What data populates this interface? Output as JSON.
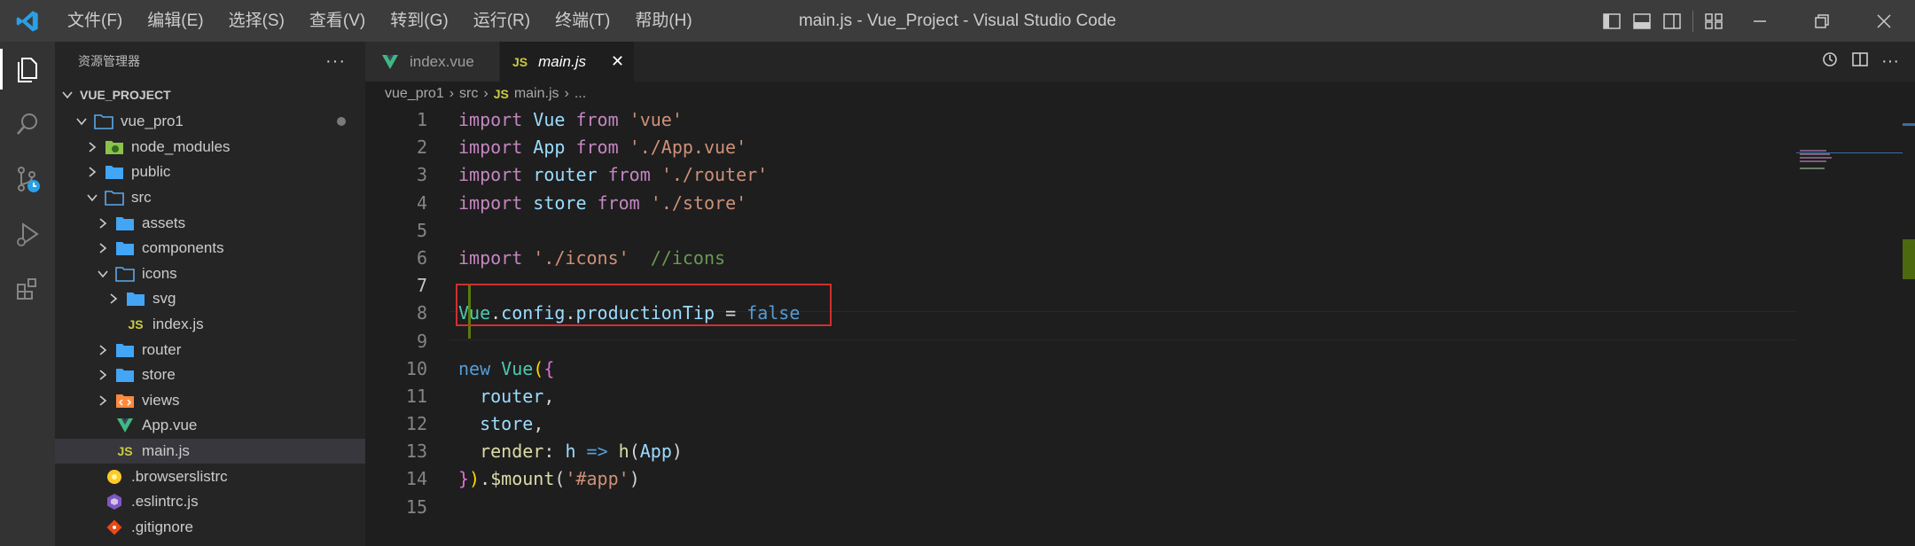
{
  "titlebar": {
    "title": "main.js - Vue_Project - Visual Studio Code",
    "menu": [
      "文件(F)",
      "编辑(E)",
      "选择(S)",
      "查看(V)",
      "转到(G)",
      "运行(R)",
      "终端(T)",
      "帮助(H)"
    ]
  },
  "sidebar": {
    "header": "资源管理器",
    "more": "···",
    "project": "VUE_PROJECT",
    "tree": [
      {
        "label": "vue_pro1",
        "type": "folder-open"
      },
      {
        "label": "node_modules",
        "type": "node-folder"
      },
      {
        "label": "public",
        "type": "folder"
      },
      {
        "label": "src",
        "type": "folder-open"
      },
      {
        "label": "assets",
        "type": "folder"
      },
      {
        "label": "components",
        "type": "folder"
      },
      {
        "label": "icons",
        "type": "folder-open"
      },
      {
        "label": "svg",
        "type": "folder"
      },
      {
        "label": "index.js",
        "type": "js"
      },
      {
        "label": "router",
        "type": "folder"
      },
      {
        "label": "store",
        "type": "folder"
      },
      {
        "label": "views",
        "type": "views-folder"
      },
      {
        "label": "App.vue",
        "type": "vue"
      },
      {
        "label": "main.js",
        "type": "js"
      },
      {
        "label": ".browserslistrc",
        "type": "browserslist"
      },
      {
        "label": ".eslintrc.js",
        "type": "eslint"
      },
      {
        "label": ".gitignore",
        "type": "git"
      }
    ]
  },
  "tabs": [
    {
      "label": "index.vue",
      "active": false
    },
    {
      "label": "main.js",
      "active": true,
      "icon_text": "JS",
      "close": "✕"
    }
  ],
  "breadcrumb": {
    "parts": [
      "vue_pro1",
      "src",
      "main.js",
      "..."
    ],
    "js_tag": "JS"
  },
  "editor": {
    "line_numbers": [
      "1",
      "2",
      "3",
      "4",
      "5",
      "6",
      "7",
      "8",
      "9",
      "10",
      "11",
      "12",
      "13",
      "14",
      "15"
    ]
  },
  "colors": {
    "accent": "#007acc",
    "highlight_box": "#d12f2f",
    "vue_green": "#41b883"
  }
}
